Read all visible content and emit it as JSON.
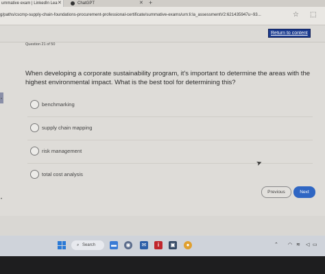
{
  "browser": {
    "tabs": [
      {
        "label": "ummative exam | LinkedIn Lea",
        "close": "✕"
      },
      {
        "label": "ChatGPT",
        "close": "✕"
      }
    ],
    "new_tab": "+",
    "url": "g/paths/cscmp-supply-chain-foundations-procurement-professional-certificate/summative-exams/urn:li:la_assessmentV2:621435947u~93..."
  },
  "page": {
    "skip_link": "Return to content",
    "question_number": "Question 21 of 50",
    "question_text": "When developing a corporate sustainability program, it's important to determine the areas with the highest environmental impact. What is the best tool for determining this?",
    "options": [
      {
        "label": "benchmarking"
      },
      {
        "label": "supply chain mapping"
      },
      {
        "label": "risk management"
      },
      {
        "label": "total cost analysis"
      }
    ],
    "buttons": {
      "previous": "Previous",
      "next": "Next"
    }
  },
  "taskbar": {
    "search_label": "Search"
  },
  "colors": {
    "accent": "#2f66c3",
    "skip_link_bg": "#1b3b8f"
  }
}
